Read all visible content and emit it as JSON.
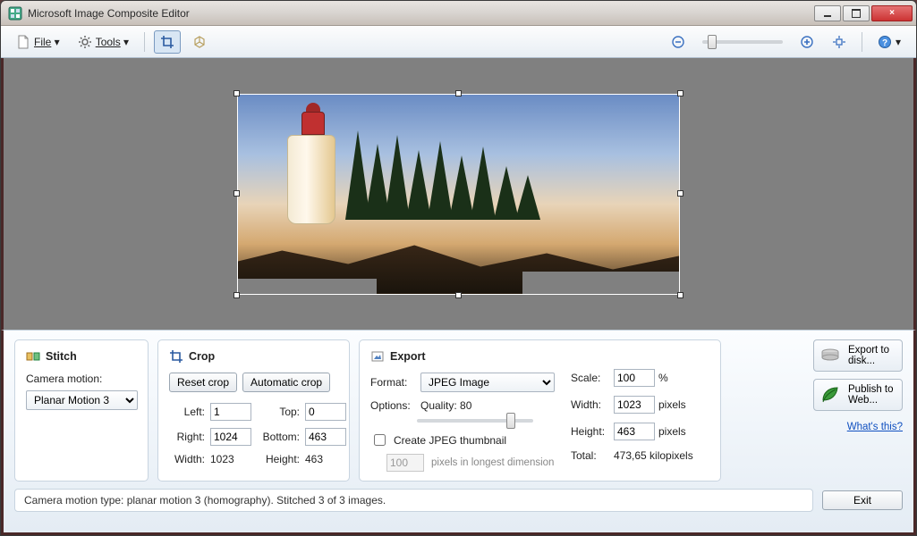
{
  "title": "Microsoft Image Composite Editor",
  "toolbar": {
    "file_label": "File",
    "tools_label": "Tools"
  },
  "stitch": {
    "heading": "Stitch",
    "camera_motion_label": "Camera motion:",
    "camera_motion_value": "Planar Motion 3"
  },
  "crop": {
    "heading": "Crop",
    "reset_label": "Reset crop",
    "auto_label": "Automatic crop",
    "left_label": "Left:",
    "left_value": "1",
    "top_label": "Top:",
    "top_value": "0",
    "right_label": "Right:",
    "right_value": "1024",
    "bottom_label": "Bottom:",
    "bottom_value": "463",
    "width_label": "Width:",
    "width_value": "1023",
    "height_label": "Height:",
    "height_value": "463"
  },
  "export": {
    "heading": "Export",
    "format_label": "Format:",
    "format_value": "JPEG Image",
    "options_label": "Options:",
    "quality_label": "Quality: 80",
    "thumb_check_label": "Create JPEG thumbnail",
    "thumb_value": "100",
    "thumb_suffix": "pixels in longest dimension",
    "scale_label": "Scale:",
    "scale_value": "100",
    "scale_unit": "%",
    "width_label": "Width:",
    "width_value": "1023",
    "width_unit": "pixels",
    "height_label": "Height:",
    "height_value": "463",
    "height_unit": "pixels",
    "total_label": "Total:",
    "total_value": "473,65 kilopixels"
  },
  "actions": {
    "export_disk": "Export to disk...",
    "publish_web": "Publish to Web...",
    "whats_this": "What's this?",
    "exit": "Exit"
  },
  "status": "Camera motion type: planar motion 3 (homography). Stitched 3 of 3 images."
}
